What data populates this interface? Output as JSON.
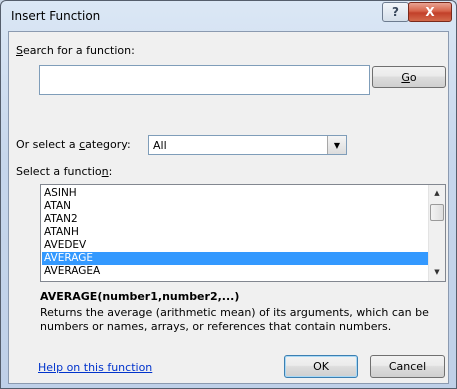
{
  "window": {
    "title": "Insert Function",
    "help_glyph": "?",
    "close_glyph": "X"
  },
  "search": {
    "label_pre": "",
    "label_key": "S",
    "label_post": "earch for a function:",
    "value": "",
    "placeholder": "",
    "go_pre": "",
    "go_key": "G",
    "go_post": "o"
  },
  "category": {
    "label_pre": "Or select a ",
    "label_key": "c",
    "label_post": "ategory:",
    "selected": "All"
  },
  "functions": {
    "label_pre": "Select a functio",
    "label_key": "n",
    "label_post": ":",
    "items": [
      "ASINH",
      "ATAN",
      "ATAN2",
      "ATANH",
      "AVEDEV",
      "AVERAGE",
      "AVERAGEA"
    ],
    "selected_index": 5
  },
  "details": {
    "signature": "AVERAGE(number1,number2,...)",
    "description": "Returns the average (arithmetic mean) of its arguments, which can be numbers or names, arrays, or references that contain numbers."
  },
  "footer": {
    "help_link": "Help on this function",
    "ok": "OK",
    "cancel": "Cancel"
  },
  "colors": {
    "selection": "#3399ff",
    "link": "#0033cc"
  }
}
